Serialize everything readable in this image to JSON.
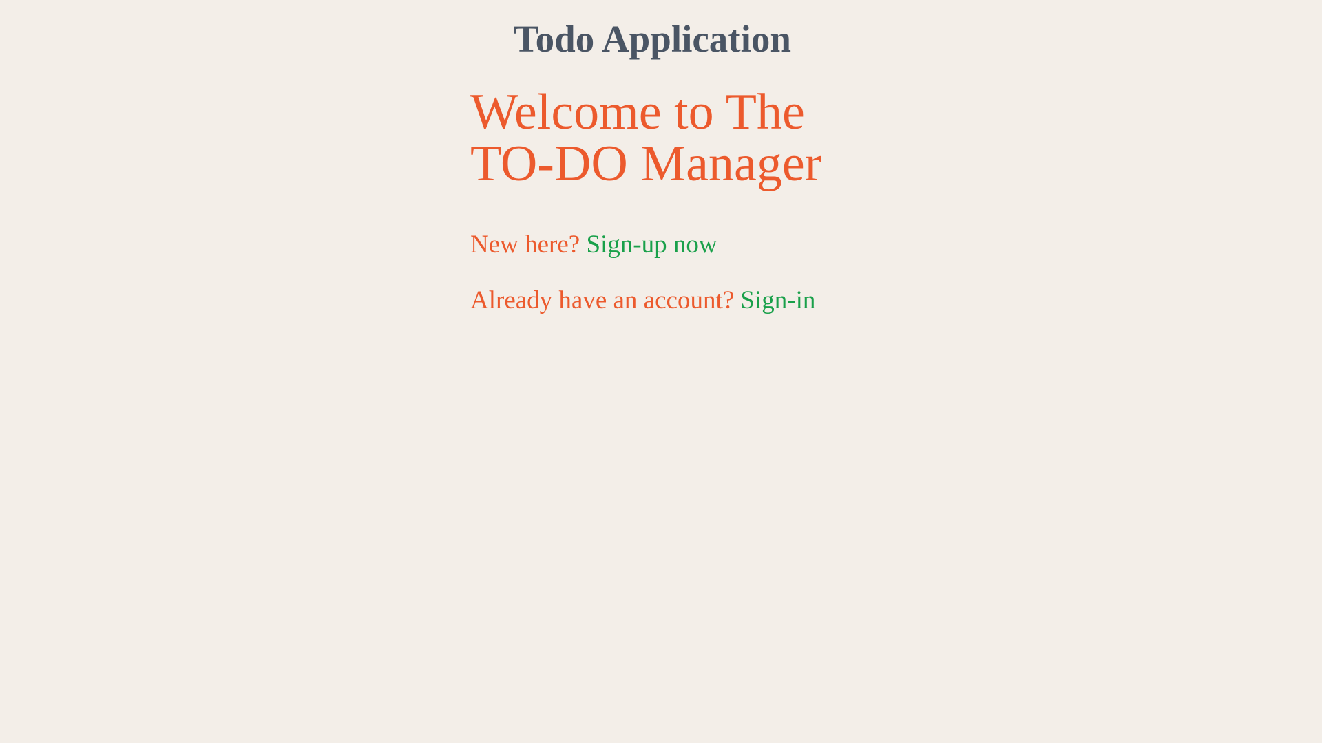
{
  "header": {
    "title": "Todo Application"
  },
  "welcome": {
    "line1": "Welcome to The",
    "line2": "TO-DO Manager"
  },
  "signup": {
    "prompt": "New here?",
    "link_label": "Sign-up now"
  },
  "signin": {
    "prompt": "Already have an account?",
    "link_label": "Sign-in"
  },
  "colors": {
    "background": "#f3eee8",
    "title": "#4a5564",
    "accent": "#ec5a2d",
    "link": "#19a04a"
  }
}
